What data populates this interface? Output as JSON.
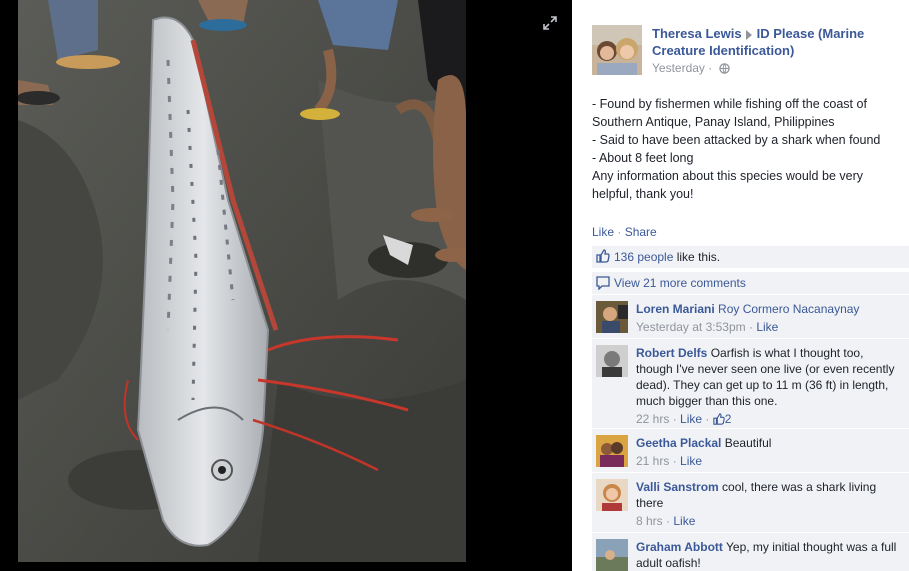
{
  "post": {
    "author": "Theresa Lewis",
    "group": "ID Please (Marine Creature Identification)",
    "time": "Yesterday",
    "privacy_icon": "globe-icon",
    "lines": [
      "- Found by fishermen while fishing off the coast of Southern Antique, Panay Island, Philippines",
      "- Said to have been attacked by a shark when found",
      "- About 8 feet long",
      "Any information about this species would be very helpful, thank you!"
    ]
  },
  "actions": {
    "like": "Like",
    "share": "Share",
    "sep": "·"
  },
  "likes": {
    "count_link": "136 people",
    "suffix": " like this."
  },
  "more_comments": "View 21 more comments",
  "comments": [
    {
      "name": "Loren Mariani",
      "tag": "Roy Cormero Nacanaynay",
      "text": "",
      "time": "Yesterday at 3:53pm",
      "like": "Like",
      "reactions": ""
    },
    {
      "name": "Robert Delfs",
      "tag": "",
      "text": "Oarfish is what I thought too, though I've never seen one live (or even recently dead). They can get up to 11 m (36 ft) in length, much bigger than this one.",
      "time": "22 hrs",
      "like": "Like",
      "reactions": "2"
    },
    {
      "name": "Geetha Plackal",
      "tag": "",
      "text": "Beautiful",
      "time": "21 hrs",
      "like": "Like",
      "reactions": ""
    },
    {
      "name": "Valli Sanstrom",
      "tag": "",
      "text": "cool, there was a shark living there",
      "time": "8 hrs",
      "like": "Like",
      "reactions": ""
    },
    {
      "name": "Graham Abbott",
      "tag": "",
      "text": "Yep, my initial thought was a full adult oafish!",
      "time": "",
      "like": "",
      "reactions": ""
    }
  ],
  "colors": {
    "link": "#3b5998",
    "muted": "#90949c",
    "ufi_bg": "#f0f2f5",
    "stage_bg": "#000000"
  }
}
